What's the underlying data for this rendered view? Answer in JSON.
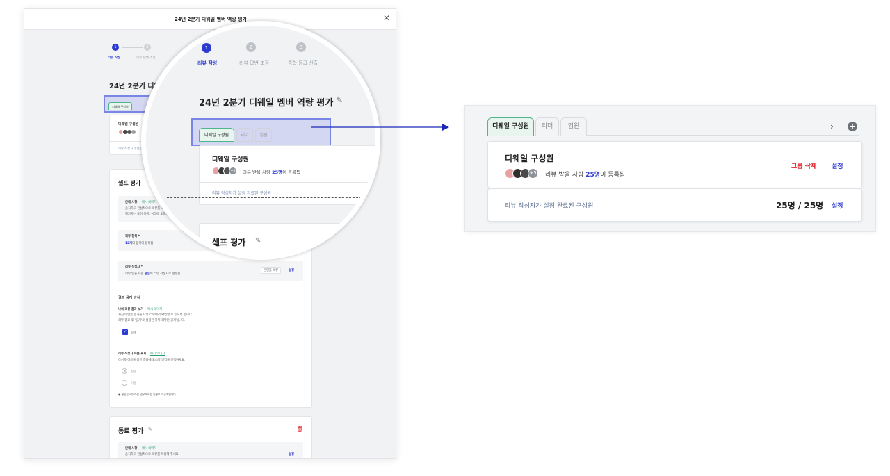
{
  "modal": {
    "title": "24년 2분기 디웨일 멤버 역량 평가",
    "close_icon": "close-icon",
    "steps": [
      {
        "number": "1",
        "label": "리뷰 작성",
        "active": true
      },
      {
        "number": "2",
        "label": "리뷰 답변 조정",
        "active": false
      },
      {
        "number": "3",
        "label": "종합 등급 산출",
        "active": false
      }
    ],
    "form_title": "24년 2분기 디웨일 멤버 역량 평가",
    "tabs": [
      "디웨일 구성원",
      "리더",
      "임원"
    ],
    "group": {
      "name": "디웨일 구성원",
      "avatar_more": "+5",
      "reviewee_prefix": "리뷰 받을 사람 ",
      "reviewee_count": "25명",
      "reviewee_suffix": "이 등록됨",
      "delete_label": "그룹 삭제",
      "settings_label": "설정",
      "writers_label": "리뷰 작성자가 설정 완료된 구성원",
      "writers_count": "25명 / 25명",
      "writers_settings_label": "설정"
    },
    "self_review": {
      "title": "셀프 평가",
      "guide_title": "안내 사항",
      "guide_link": "예시 의미지",
      "guide_line1": "솔직하고 건설적으로 리뷰를 작성해 주세요.",
      "guide_line2": "평가자는 모아 이미, 성장에 도움되는 피드백을 남겨 주세요.",
      "items_title": "리뷰 항목 *",
      "items_count": "12개",
      "items_suffix": "의 항목이 등록됨",
      "writer_title": "리뷰 작성자 *",
      "writer_prefix": "리뷰 받을 사람 ",
      "writer_self": "본인",
      "writer_suffix": "이 리뷰 작성자로 설정됨",
      "writer_chip": "본인을 리뷰",
      "writer_settings": "설정",
      "result_title": "결과 공개 방식",
      "result_sub": "나의 리뷰 결과 보기",
      "result_link": "예시 의미지",
      "result_line1": "자신이 받은 결과를 나의 리뷰에서 확인할 수 있도록 합니다.",
      "result_line2": "리뷰 종료 후 '공개'로 설정된 하위 리뷰만 공개됩니다.",
      "public_label": "공개",
      "name_title": "리뷰 작성자 이름 표시",
      "name_link": "예시 의미지",
      "name_desc": "작성자 이름을 리뷰 결과에 표시할 방법을 선택하세요.",
      "opt_real": "실명",
      "opt_anon": "익명",
      "note": "본인을 리뷰하는 경우에에는 일본으로 공개됩니다."
    },
    "peer_review": {
      "title": "동료 평가",
      "guide_title": "안내 사항",
      "guide_link": "예시 의미지",
      "guide_line1": "솔직하고 건설적으로 리뷰를 작성해 주세요.",
      "settings_label": "설정"
    }
  },
  "colors": {
    "primary": "#2b3bd0",
    "accent_green": "#4fb58a",
    "danger": "#e0242b",
    "highlight": "#5a68e0"
  }
}
